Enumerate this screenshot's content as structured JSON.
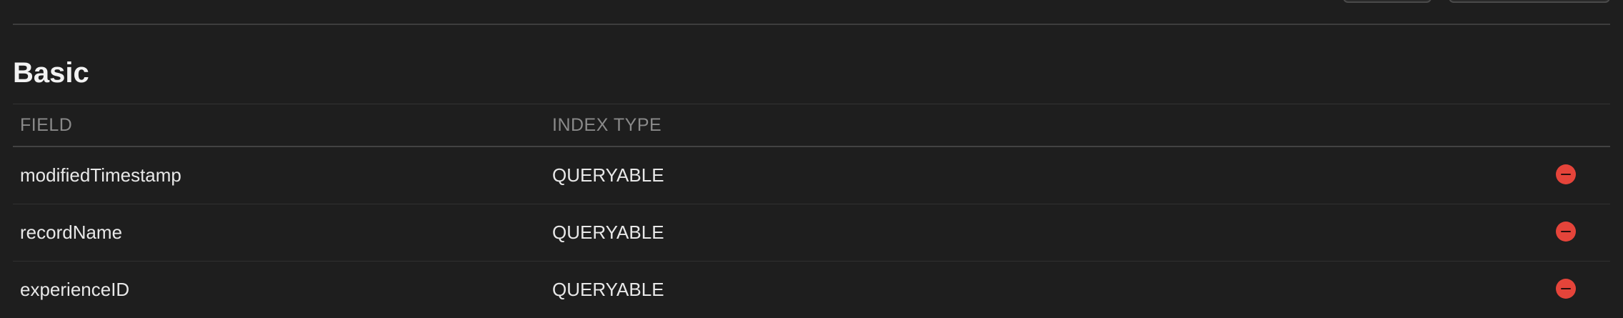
{
  "section": {
    "title": "Basic"
  },
  "table": {
    "columns": {
      "field": "FIELD",
      "index_type": "INDEX TYPE"
    },
    "rows": [
      {
        "field": "modifiedTimestamp",
        "index_type": "QUERYABLE",
        "action_icon": "remove-circle-icon"
      },
      {
        "field": "recordName",
        "index_type": "QUERYABLE",
        "action_icon": "remove-circle-icon"
      },
      {
        "field": "experienceID",
        "index_type": "QUERYABLE",
        "action_icon": "remove-circle-icon"
      }
    ]
  },
  "colors": {
    "background": "#1e1e1e",
    "text": "#e8e8e8",
    "header_text": "#8a8a8a",
    "remove_accent": "#e5443a"
  }
}
